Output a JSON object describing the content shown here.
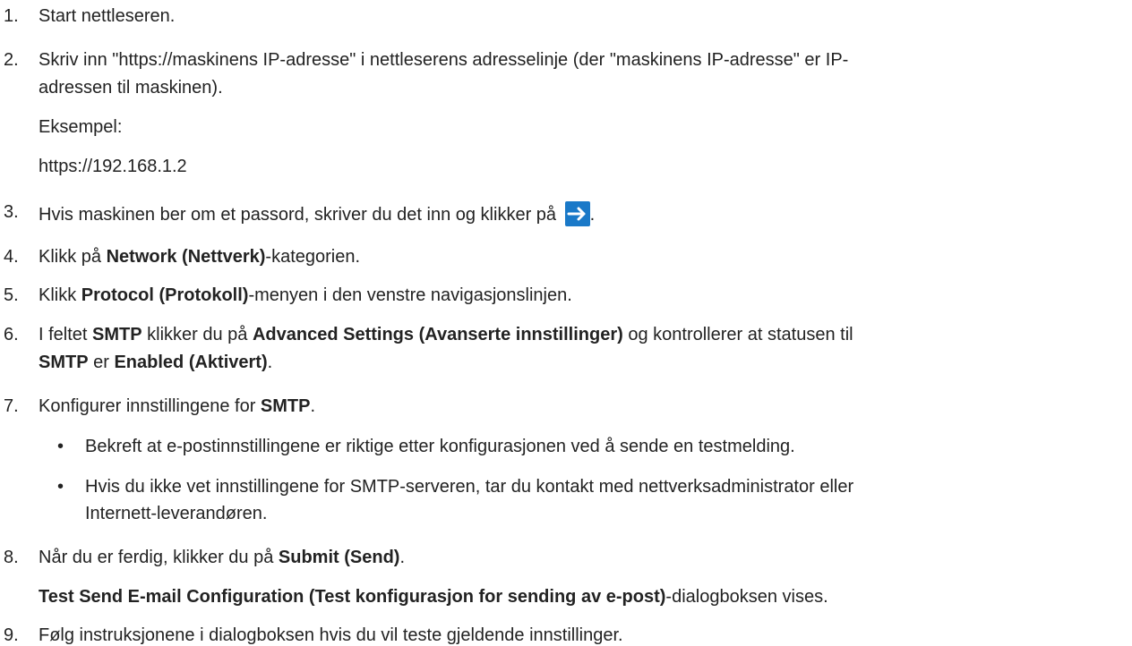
{
  "steps": [
    {
      "num": "1.",
      "text": "Start nettleseren."
    },
    {
      "num": "2.",
      "line1": "Skriv inn \"https://maskinens IP-adresse\" i nettleserens adresselinje (der \"maskinens IP-adresse\" er IP-",
      "line2": "adressen til maskinen).",
      "example_label": "Eksempel:",
      "example_value": "https://192.168.1.2"
    },
    {
      "num": "3.",
      "before": "Hvis maskinen ber om et passord, skriver du det inn og klikker på ",
      "after": ".",
      "icon": "arrow-right-icon"
    },
    {
      "num": "4.",
      "pre": "Klikk på ",
      "bold": "Network (Nettverk)",
      "post": "-kategorien."
    },
    {
      "num": "5.",
      "pre": "Klikk ",
      "bold": "Protocol (Protokoll)",
      "post": "-menyen i den venstre navigasjonslinjen."
    },
    {
      "num": "6.",
      "t1": "I feltet ",
      "b1": "SMTP",
      "t2": " klikker du på ",
      "b2": "Advanced Settings (Avanserte innstillinger)",
      "t3": " og kontrollerer at statusen til",
      "b3": "SMTP",
      "t4": " er ",
      "b4": "Enabled (Aktivert)",
      "t5": "."
    },
    {
      "num": "7.",
      "pre": "Konfigurer innstillingene for ",
      "bold": "SMTP",
      "post": ".",
      "bullets": [
        {
          "line1": "Bekreft at e-postinnstillingene er riktige etter konfigurasjonen ved å sende en testmelding."
        },
        {
          "line1": "Hvis du ikke vet innstillingene for SMTP-serveren, tar du kontakt med nettverksadministrator eller",
          "line2": "Internett-leverandøren."
        }
      ]
    },
    {
      "num": "8.",
      "pre": "Når du er ferdig, klikker du på ",
      "bold": "Submit (Send)",
      "post": ".",
      "note_bold": "Test Send E-mail Configuration (Test konfigurasjon for sending av e-post)",
      "note_post": "-dialogboksen vises."
    },
    {
      "num": "9.",
      "text": "Følg instruksjonene i dialogboksen hvis du vil teste gjeldende innstillinger."
    }
  ],
  "bullet_char": "•",
  "colors": {
    "text": "#222222",
    "icon_bg": "#1a79c8"
  }
}
